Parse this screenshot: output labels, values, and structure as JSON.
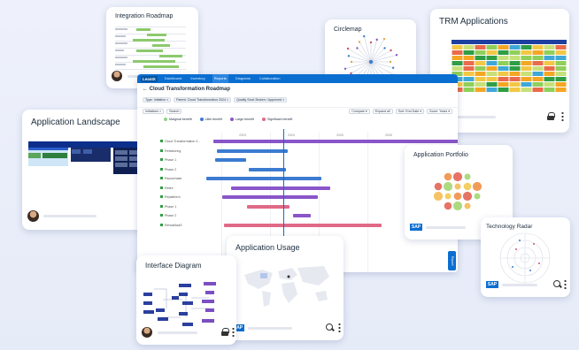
{
  "cards": {
    "integration": {
      "title": "Integration Roadmap"
    },
    "circlemap": {
      "title": "Circlemap"
    },
    "trm": {
      "title": "TRM Applications"
    },
    "landscape": {
      "title": "Application Landscape"
    },
    "portfolio": {
      "title": "Application Portfolio"
    },
    "radar": {
      "title": "Technology Radar"
    },
    "usage": {
      "title": "Application Usage"
    },
    "interface": {
      "title": "Interface Diagram"
    }
  },
  "roadmap": {
    "shell": {
      "logo": "LeanIX",
      "nav": [
        "Dashboard",
        "Inventory",
        "Reports",
        "Diagrams",
        "Collaboration"
      ],
      "active_index": 2
    },
    "title": "Cloud Transformation Roadmap",
    "filters": [
      "Type: Initiative ×",
      "Parent: Cloud Transformation 2024 ×",
      "Quality Seal: Broken / Approved ×"
    ],
    "toolbar": {
      "view": "Initiatives ×",
      "search": "Search",
      "compare": "Compare ▾",
      "expand": "Expand all",
      "sort": "Sort: End Date ▾",
      "zoom": "Zoom: Years ▾"
    },
    "legend": [
      {
        "label": "Marginal benefit",
        "color": "#8fd18c"
      },
      {
        "label": "Little benefit",
        "color": "#3b7bd0"
      },
      {
        "label": "Large benefit",
        "color": "#8a55c9"
      },
      {
        "label": "Significant benefit",
        "color": "#e06a86"
      }
    ],
    "years": [
      "2023",
      "2024",
      "2025",
      "2026"
    ],
    "rows": [
      "Cloud Transformation 2...",
      "Refactoring",
      "Phase 1",
      "Phase 2",
      "Repurchase",
      "Retire",
      "Replatform",
      "Phase 1",
      "Phase 2",
      "Rehost/laaS"
    ],
    "side_button": "Report"
  }
}
